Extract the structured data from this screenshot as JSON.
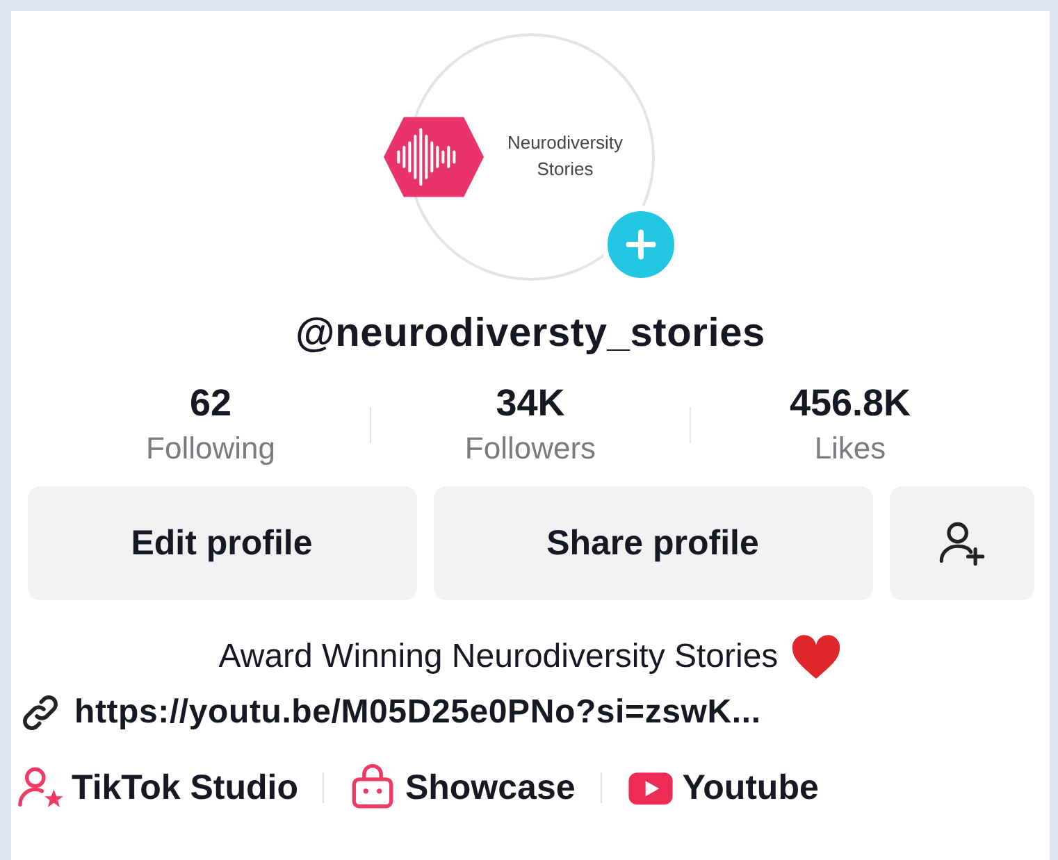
{
  "avatar": {
    "logo_text": "Neurodiversity Stories"
  },
  "username": "@neurodiversty_stories",
  "stats": [
    {
      "value": "62",
      "label": "Following"
    },
    {
      "value": "34K",
      "label": "Followers"
    },
    {
      "value": "456.8K",
      "label": "Likes"
    }
  ],
  "buttons": [
    {
      "kind": "text",
      "label": "Edit profile"
    },
    {
      "kind": "text",
      "label": "Share profile"
    },
    {
      "kind": "add-friend"
    }
  ],
  "bio": "Award Winning Neurodiversity Stories",
  "link": "https://youtu.be/M05D25e0PNo?si=zswK...",
  "shortcuts": [
    {
      "kind": "studio",
      "label": "TikTok Studio"
    },
    {
      "kind": "showcase",
      "label": "Showcase"
    },
    {
      "kind": "youtube",
      "label": "Youtube"
    }
  ]
}
